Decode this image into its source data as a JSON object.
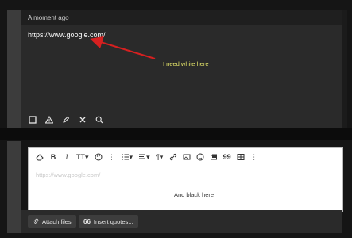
{
  "message": {
    "timestamp": "A moment ago",
    "text": "https://www.google.com/"
  },
  "annotations": {
    "white_note": "I need white here",
    "black_note": "And black here",
    "arrow_color": "#d62020"
  },
  "message_actions": [
    "checkbox-icon",
    "warning-icon",
    "pencil-icon",
    "close-icon",
    "search-icon"
  ],
  "editor": {
    "placeholder": "https://www.google.com/",
    "toolbar_icons": [
      "eraser-icon",
      "bold-icon",
      "italic-icon",
      "text-size-icon",
      "palette-icon",
      "more-icon",
      "list-icon",
      "align-icon",
      "paragraph-icon",
      "link-icon",
      "image-icon",
      "emoji-icon",
      "media-icon",
      "quote-icon",
      "table-icon",
      "more-icon"
    ],
    "toolbar_labels": {
      "bold": "B",
      "italic": "I",
      "text_size": "TT",
      "paragraph": "¶",
      "quote": "99"
    }
  },
  "footer": {
    "attach_label": "Attach files",
    "insert_quotes_label": "Insert quotes..."
  }
}
